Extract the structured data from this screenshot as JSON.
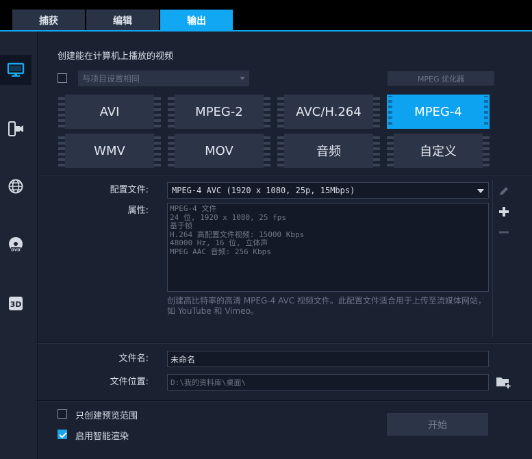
{
  "tabs": [
    {
      "label": "捕获"
    },
    {
      "label": "编辑"
    },
    {
      "label": "输出"
    }
  ],
  "active_tab": "输出",
  "sidebar": {
    "items": [
      {
        "icon": "monitor-icon",
        "active": true
      },
      {
        "icon": "phone-camera-icon"
      },
      {
        "icon": "globe-icon"
      },
      {
        "icon": "dvd-disc-icon"
      },
      {
        "icon": "3d-icon"
      }
    ]
  },
  "main": {
    "heading": "创建能在计算机上播放的视频",
    "project_settings_select": "与项目设置相同",
    "mpeg_optimizer_label": "MPEG 优化器",
    "formats": [
      {
        "label": "AVI"
      },
      {
        "label": "MPEG-2"
      },
      {
        "label": "AVC/H.264"
      },
      {
        "label": "MPEG-4"
      },
      {
        "label": "WMV"
      },
      {
        "label": "MOV"
      },
      {
        "label": "音频"
      },
      {
        "label": "自定义"
      }
    ],
    "selected_format": "MPEG-4",
    "profile_label": "配置文件:",
    "profile_value": "MPEG-4 AVC (1920 x 1080, 25p, 15Mbps)",
    "properties_label": "属性:",
    "properties_lines": [
      "MPEG-4 文件",
      "24 位, 1920 x 1080, 25 fps",
      "基于帧",
      "H.264 高配置文件视频: 15000 Kbps",
      "48000 Hz, 16 位, 立体声",
      "MPEG AAC 音频: 256 Kbps"
    ],
    "description": "创建高比特率的高清 MPEG-4 AVC 视频文件。此配置文件适合用于上传至流媒体网站，如 YouTube 和 Vimeo。",
    "filename_label": "文件名:",
    "filename_value": "未命名",
    "location_label": "文件位置:",
    "location_value": "D:\\我的资料库\\桌面\\",
    "preview_range_label": "只创建预览范围",
    "preview_range_checked": false,
    "smart_render_label": "启用智能渲染",
    "smart_render_checked": true,
    "start_button": "开始"
  },
  "colors": {
    "accent": "#11a7f2",
    "background": "#1a2131",
    "tile": "#2c3447"
  }
}
